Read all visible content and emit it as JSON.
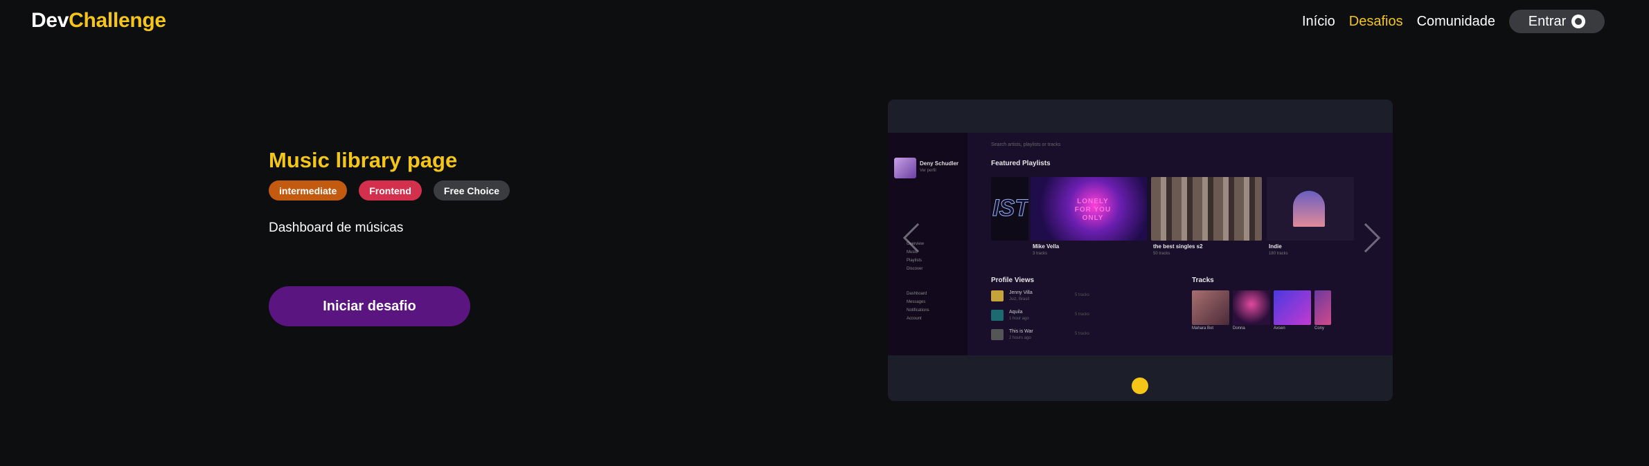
{
  "header": {
    "logo_part1": "Dev",
    "logo_part2": "Challenge",
    "nav": {
      "home": "Início",
      "challenges": "Desafios",
      "community": "Comunidade",
      "login": "Entrar"
    }
  },
  "challenge": {
    "title": "Music library page",
    "tags": {
      "level": "intermediate",
      "area": "Frontend",
      "choice": "Free Choice"
    },
    "description": "Dashboard de músicas",
    "start_label": "Iniciar desafio"
  },
  "preview": {
    "user_name": "Deny Schudler",
    "user_sub": "Ver perfil",
    "search_placeholder": "Search artists, playlists or tracks",
    "featured_title": "Featured Playlists",
    "first_tile_text": "IST",
    "neon_text": "LONELY FOR YOU ONLY",
    "playlists": [
      {
        "name": "Mike Vella",
        "sub": "3 tracks"
      },
      {
        "name": "the best singles s2",
        "sub": "50 tracks"
      },
      {
        "name": "Indie",
        "sub": "180 tracks"
      }
    ],
    "menu_top": [
      "Overview",
      "Music",
      "Playlists",
      "Discover"
    ],
    "menu_bottom": [
      "Dashboard",
      "Messages",
      "Notifications",
      "Account"
    ],
    "profile_views_title": "Profile Views",
    "profile_views": [
      {
        "name": "Jenny Villa",
        "sub": "Juiz, Brasil",
        "value": "5 tracks"
      },
      {
        "name": "Aquila",
        "sub": "1 hour ago",
        "value": "5 tracks"
      },
      {
        "name": "This is War",
        "sub": "2 hours ago",
        "value": "5 tracks"
      }
    ],
    "tracks_title": "Tracks",
    "tracks": [
      "Mahara Bot",
      "Donna",
      "Axsen",
      "Cony"
    ]
  },
  "colors": {
    "background": "#0d0e10",
    "accent": "#f5c518",
    "level_tag": "#c25a10",
    "area_tag": "#d3304d",
    "choice_tag": "#3b3c3f",
    "start_button": "#5a1580",
    "carousel_bg": "#1c1f29"
  },
  "icons": {
    "github": "github-icon",
    "prev": "chevron-left-icon",
    "next": "chevron-right-icon"
  }
}
